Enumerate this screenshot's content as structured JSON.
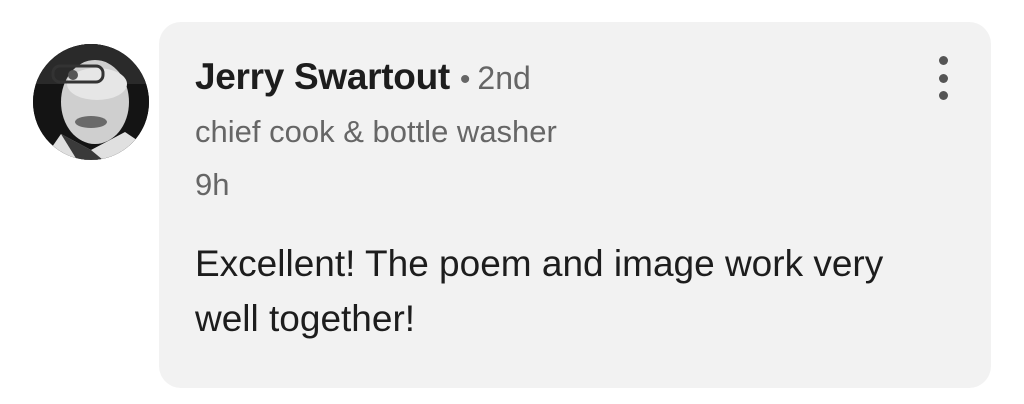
{
  "comment": {
    "author": {
      "name": "Jerry Swartout",
      "separator": "•",
      "connection_degree": "2nd",
      "headline": "chief cook & bottle washer"
    },
    "timestamp": "9h",
    "text": "Excellent! The poem and image work very well together!",
    "menu_icon": "more-vertical-icon",
    "avatar_icon": "profile-photo"
  },
  "colors": {
    "bubble_background": "#f2f2f2",
    "primary_text": "#1d1d1d",
    "secondary_text": "#666666"
  }
}
